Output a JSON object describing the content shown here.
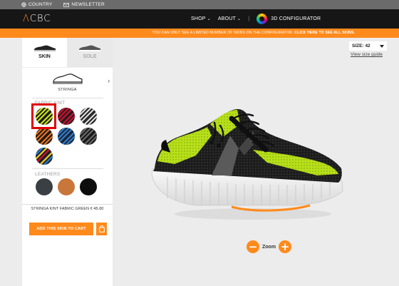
{
  "utility": {
    "country": "COUNTRY",
    "newsletter": "NEWSLETTER"
  },
  "nav": {
    "logo": "CBC",
    "logo_mark": "Λ",
    "shop": "SHOP",
    "about": "ABOUT",
    "separator": "|",
    "configurator": "3D CONFIGURATOR"
  },
  "promo": {
    "text": "YOU CAN ONLY SEE A LIMITED NUMBER OF SKINS ON THE CONFIGURATOR. ",
    "link": "CLICK HERE TO SEE ALL SKINS."
  },
  "tabs": {
    "skin": "SKIN",
    "sole": "SOLE"
  },
  "model": {
    "name": "STRINGA"
  },
  "sections": {
    "fabric_knit": "FABRIC KNIT",
    "leathers": "LEATHERS"
  },
  "product": {
    "name": "STRINGA KINT FABRIC GREEN",
    "price": "€ 45.00"
  },
  "cart": {
    "add_label": "ADD THIS SKIN TO CART"
  },
  "size": {
    "label": "SIZE:",
    "value": "42",
    "guide": "View size guide"
  },
  "zoom": {
    "label": "Zoom",
    "minus": "−",
    "plus": "+"
  },
  "colors": {
    "accent": "#ff8a1c",
    "nav_bg": "#161616",
    "utility_bg": "#6b6b6b",
    "selected_outline": "#e10000"
  }
}
